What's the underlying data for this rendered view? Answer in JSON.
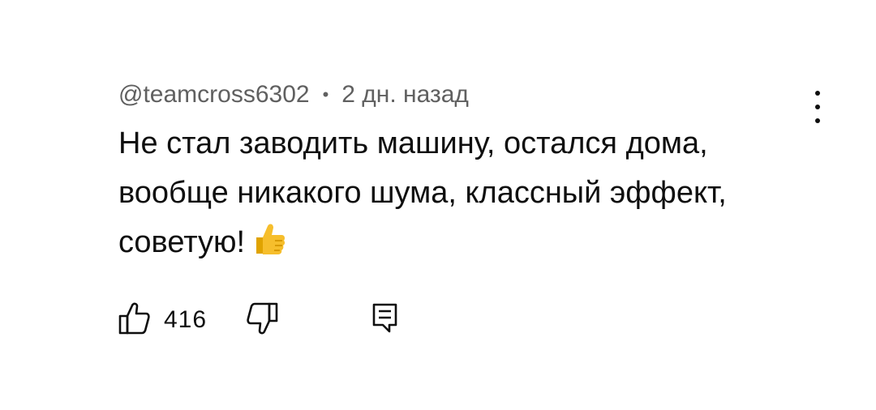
{
  "comment": {
    "author": "@teamcross6302",
    "separator": "•",
    "time": "2 дн. назад",
    "lines": [
      "Не стал заводить машину, остался дома,",
      "вообще никакого шума, классный эффект,",
      "советую!"
    ],
    "emoji_icon": "thumbs-up-emoji"
  },
  "actions": {
    "like_icon": "thumbs-up-outline-icon",
    "like_count": "416",
    "dislike_icon": "thumbs-down-outline-icon",
    "reply_icon": "comment-reply-icon"
  },
  "menu": {
    "icon": "more-vertical-icon"
  },
  "colors": {
    "text": "#0f0f0f",
    "meta": "#606060",
    "emoji": "#f4b400"
  }
}
